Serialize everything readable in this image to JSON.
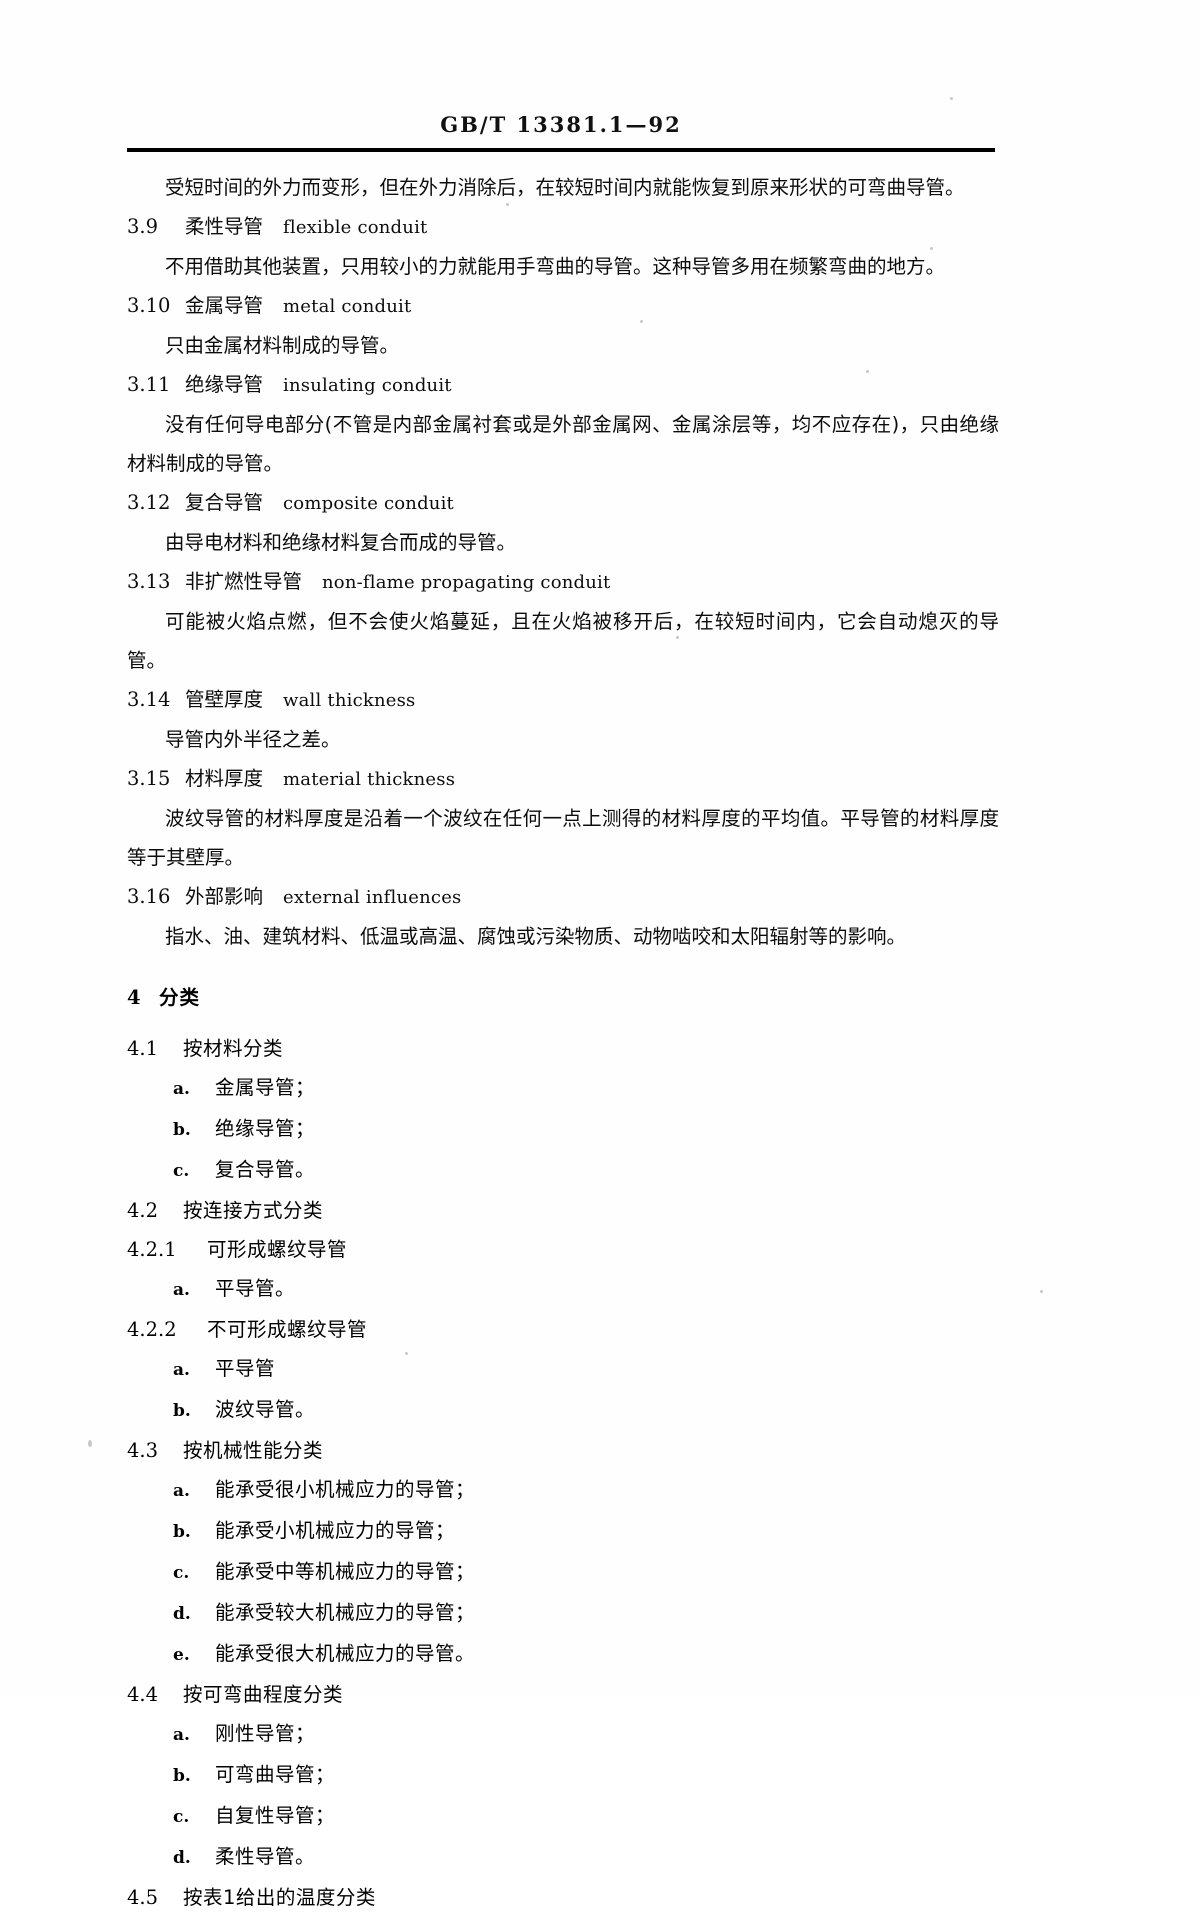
{
  "header": {
    "standard_number": "GB/T  13381.1—92"
  },
  "body": {
    "continued_paragraph": "受短时间的外力而变形，但在外力消除后，在较短时间内就能恢复到原来形状的可弯曲导管。",
    "definitions": [
      {
        "number": "3.9",
        "term": "柔性导管",
        "english": "flexible conduit",
        "text": "不用借助其他装置，只用较小的力就能用手弯曲的导管。这种导管多用在频繁弯曲的地方。"
      },
      {
        "number": "3.10",
        "term": "金属导管",
        "english": "metal conduit",
        "text": "只由金属材料制成的导管。"
      },
      {
        "number": "3.11",
        "term": "绝缘导管",
        "english": "insulating conduit",
        "text": "没有任何导电部分(不管是内部金属衬套或是外部金属网、金属涂层等，均不应存在)，只由绝缘材料制成的导管。"
      },
      {
        "number": "3.12",
        "term": "复合导管",
        "english": "composite conduit",
        "text": "由导电材料和绝缘材料复合而成的导管。"
      },
      {
        "number": "3.13",
        "term": "非扩燃性导管",
        "english": "non-flame propagating conduit",
        "text": "可能被火焰点燃，但不会使火焰蔓延，且在火焰被移开后，在较短时间内，它会自动熄灭的导管。"
      },
      {
        "number": "3.14",
        "term": "管壁厚度",
        "english": "wall thickness",
        "text": "导管内外半径之差。"
      },
      {
        "number": "3.15",
        "term": "材料厚度",
        "english": "material thickness",
        "text": "波纹导管的材料厚度是沿着一个波纹在任何一点上测得的材料厚度的平均值。平导管的材料厚度等于其壁厚。"
      },
      {
        "number": "3.16",
        "term": "外部影响",
        "english": "external influences",
        "text": "指水、油、建筑材料、低温或高温、腐蚀或污染物质、动物啮咬和太阳辐射等的影响。"
      }
    ],
    "section4": {
      "number": "4",
      "title": "分类",
      "subsections": [
        {
          "number": "4.1",
          "title": "按材料分类",
          "items": [
            {
              "marker": "a.",
              "text": "金属导管；"
            },
            {
              "marker": "b.",
              "text": "绝缘导管；"
            },
            {
              "marker": "c.",
              "text": "复合导管。"
            }
          ]
        },
        {
          "number": "4.2",
          "title": "按连接方式分类",
          "items": []
        },
        {
          "number": "4.2.1",
          "title": "可形成螺纹导管",
          "items": [
            {
              "marker": "a.",
              "text": "平导管。"
            }
          ]
        },
        {
          "number": "4.2.2",
          "title": "不可形成螺纹导管",
          "items": [
            {
              "marker": "a.",
              "text": "平导管"
            },
            {
              "marker": "b.",
              "text": "波纹导管。"
            }
          ]
        },
        {
          "number": "4.3",
          "title": "按机械性能分类",
          "items": [
            {
              "marker": "a.",
              "text": "能承受很小机械应力的导管；"
            },
            {
              "marker": "b.",
              "text": "能承受小机械应力的导管；"
            },
            {
              "marker": "c.",
              "text": "能承受中等机械应力的导管；"
            },
            {
              "marker": "d.",
              "text": "能承受较大机械应力的导管；"
            },
            {
              "marker": "e.",
              "text": "能承受很大机械应力的导管。"
            }
          ]
        },
        {
          "number": "4.4",
          "title": "按可弯曲程度分类",
          "items": [
            {
              "marker": "a.",
              "text": "刚性导管；"
            },
            {
              "marker": "b.",
              "text": "可弯曲导管；"
            },
            {
              "marker": "c.",
              "text": "自复性导管；"
            },
            {
              "marker": "d.",
              "text": "柔性导管。"
            }
          ]
        },
        {
          "number": "4.5",
          "title": "按表1给出的温度分类",
          "items": []
        }
      ]
    }
  }
}
